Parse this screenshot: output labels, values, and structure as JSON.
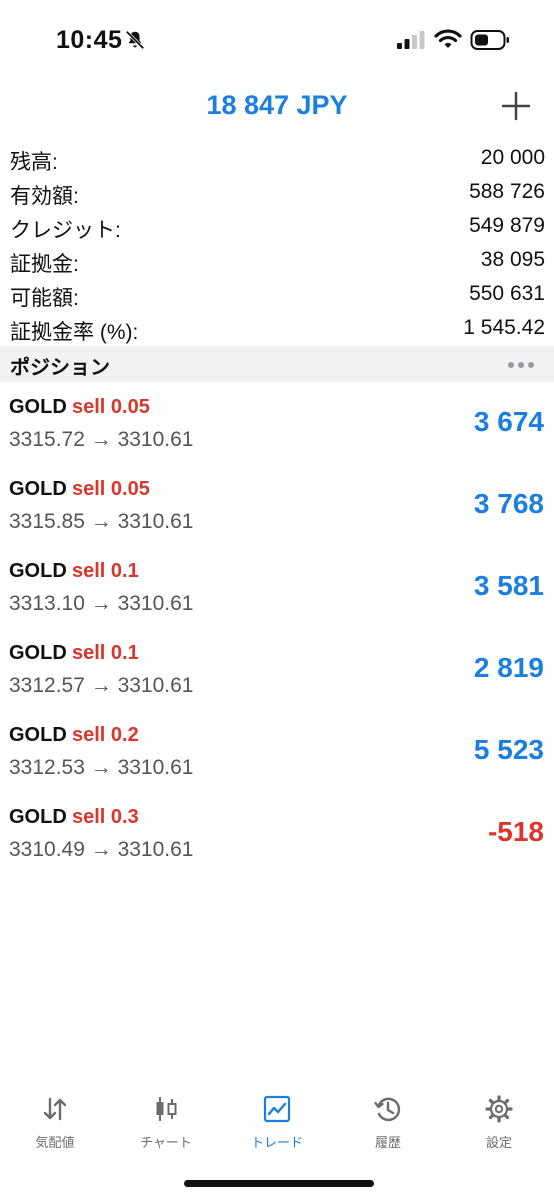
{
  "status_bar": {
    "time": "10:45"
  },
  "header": {
    "balance_title": "18 847 JPY"
  },
  "summary": [
    {
      "label": "残高:",
      "value": "20 000"
    },
    {
      "label": "有効額:",
      "value": "588 726"
    },
    {
      "label": "クレジット:",
      "value": "549 879"
    },
    {
      "label": "証拠金:",
      "value": "38 095"
    },
    {
      "label": "可能額:",
      "value": "550 631"
    },
    {
      "label": "証拠金率 (%):",
      "value": "1 545.42"
    }
  ],
  "section": {
    "title": "ポジション"
  },
  "positions": [
    {
      "symbol": "GOLD",
      "side": "sell 0.05",
      "prices": "3315.72 → 3310.61",
      "profit": "3 674"
    },
    {
      "symbol": "GOLD",
      "side": "sell 0.05",
      "prices": "3315.85 → 3310.61",
      "profit": "3 768"
    },
    {
      "symbol": "GOLD",
      "side": "sell 0.1",
      "prices": "3313.10 → 3310.61",
      "profit": "3 581"
    },
    {
      "symbol": "GOLD",
      "side": "sell 0.1",
      "prices": "3312.57 → 3310.61",
      "profit": "2 819"
    },
    {
      "symbol": "GOLD",
      "side": "sell 0.2",
      "prices": "3312.53 → 3310.61",
      "profit": "5 523"
    },
    {
      "symbol": "GOLD",
      "side": "sell 0.3",
      "prices": "3310.49 → 3310.61",
      "profit": "-518"
    }
  ],
  "tabs": [
    {
      "label": "気配値",
      "icon": "quotes-arrows-icon"
    },
    {
      "label": "チャート",
      "icon": "candlestick-icon"
    },
    {
      "label": "トレード",
      "icon": "trade-chart-icon",
      "active": true
    },
    {
      "label": "履歴",
      "icon": "history-clock-icon"
    },
    {
      "label": "設定",
      "icon": "gear-icon"
    }
  ],
  "colors": {
    "accent": "#1a7fe0",
    "loss": "#d9372b",
    "section_bg": "#f2f2f4"
  }
}
